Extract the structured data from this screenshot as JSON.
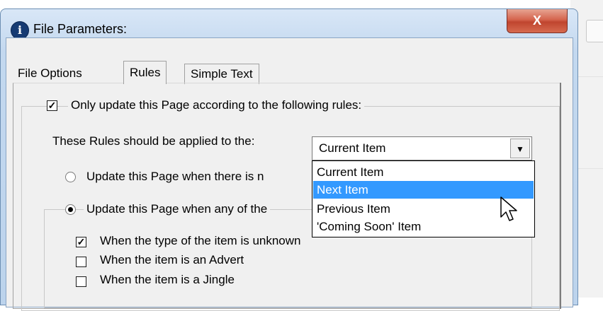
{
  "window": {
    "title": "File Parameters:",
    "close_glyph": "X",
    "icon": "info-icon"
  },
  "tabs": [
    {
      "label": "File Options",
      "active": false
    },
    {
      "label": "Rules",
      "active": true
    },
    {
      "label": "Simple Text",
      "active": false
    }
  ],
  "rules": {
    "enable_checkbox": {
      "label": "Only update this Page according to the following rules:",
      "checked": true
    },
    "applied_to_label": "These Rules should be applied to the:",
    "applied_to_value": "Current Item",
    "dropdown_options": [
      "Current Item",
      "Next Item",
      "Previous Item",
      "'Coming Soon' Item"
    ],
    "dropdown_highlighted": "Next Item",
    "radio_option_1": {
      "label": "Update this Page when there is n",
      "selected": false
    },
    "radio_option_2": {
      "label": "Update this Page when any of the",
      "selected": true
    },
    "conditions": [
      {
        "label": "When the type of the item is unknown",
        "checked": true
      },
      {
        "label": "When the item is an Advert",
        "checked": false
      },
      {
        "label": "When the item is a Jingle",
        "checked": false
      }
    ]
  },
  "colors": {
    "selection": "#3399ff",
    "close_button": "#c9503a",
    "title_bar": "#c9dcf1"
  }
}
